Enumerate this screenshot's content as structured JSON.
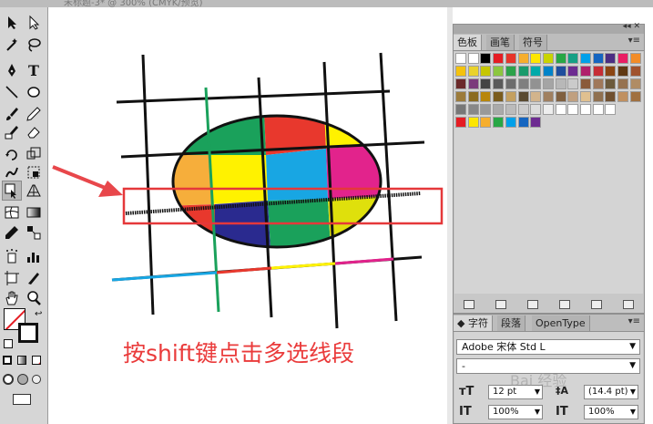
{
  "window": {
    "doc_title": "未标题-3* @ 300% (CMYK/预览)"
  },
  "tools": {
    "items": [
      "selection-tool",
      "direct-selection-tool",
      "magic-wand-tool",
      "lasso-tool",
      "pen-tool",
      "type-tool",
      "line-tool",
      "ellipse-tool",
      "paintbrush-tool",
      "pencil-tool",
      "blob-brush-tool",
      "eraser-tool",
      "rotate-tool",
      "scale-tool",
      "warp-tool",
      "free-transform-tool",
      "shape-builder-tool",
      "perspective-tool",
      "mesh-tool",
      "gradient-tool",
      "eyedropper-tool",
      "blend-tool",
      "symbol-sprayer-tool",
      "column-graph-tool",
      "artboard-tool",
      "slice-tool",
      "hand-tool",
      "zoom-tool"
    ]
  },
  "canvas": {
    "caption": "按shift键点击多选线段",
    "colors": {
      "green": "#1aa15b",
      "red": "#e8382d",
      "yellow": "#fff200",
      "orange": "#f6ae3b",
      "cyan": "#18a6e3",
      "magenta": "#e2238c",
      "navy": "#2a2a8f",
      "lime": "#dfe00c",
      "highlight": "#e5383a",
      "arrow": "#e8474b"
    }
  },
  "swatches_panel": {
    "tabs": [
      "色板",
      "画笔",
      "符号"
    ],
    "active_tab": "色板",
    "rows": [
      [
        "#ffffff",
        "#ffffff",
        "#000000",
        "#e51c23",
        "#e7342a",
        "#f6ae2d",
        "#fde600",
        "#c9d400",
        "#28a745",
        "#16a085",
        "#00a0e9",
        "#1565c0",
        "#4b2e83",
        "#e91e63",
        "#f28c28"
      ],
      [
        "#f4c20d",
        "#e9d22b",
        "#c6c600",
        "#8cc63f",
        "#2ca24a",
        "#1a9b6c",
        "#0aa",
        "#0083c9",
        "#1f4e9d",
        "#6d2c91",
        "#b01f6b",
        "#c62d35",
        "#8b4513",
        "#603913",
        "#a0522d"
      ],
      [
        "#6b2a2a",
        "#7b3b7b",
        "#444444",
        "#5a5a5a",
        "#6d6d6d",
        "#7f7f7f",
        "#929292",
        "#a5a5a5",
        "#b8b8b8",
        "#cbcbcb",
        "#8a5a3a",
        "#a0785a",
        "#6c5a3c",
        "#96724f",
        "#b08c64"
      ],
      [
        "#9c7b3a",
        "#8b6c20",
        "#b8860b",
        "#7a5c1e",
        "#c4a060",
        "#5a4a30",
        "#d2b48c",
        "#a08060",
        "#806040",
        "#c0a080",
        "#e0c090",
        "#907050",
        "#705030",
        "#c09060",
        "#a07040"
      ],
      [
        "#777777",
        "#888888",
        "#999999",
        "#aaaaaa",
        "#bbbbbb",
        "#cccccc",
        "#dddddd",
        "#eeeeee",
        "#ffffff",
        "#ffffff",
        "#ffffff",
        "#ffffff",
        "#ffffff"
      ],
      [
        "#e51c23",
        "#fde600",
        "#f6ae2d",
        "#28a745",
        "#00a0e9",
        "#1565c0",
        "#6d2c91"
      ]
    ]
  },
  "character_panel": {
    "tabs": [
      "字符",
      "段落",
      "OpenType"
    ],
    "active_tab": "字符",
    "font_family": "Adobe 宋体 Std L",
    "font_style": "-",
    "font_size": "12 pt",
    "leading": "(14.4 pt)",
    "vertical_scale": "100%",
    "horizontal_scale": "100%"
  }
}
